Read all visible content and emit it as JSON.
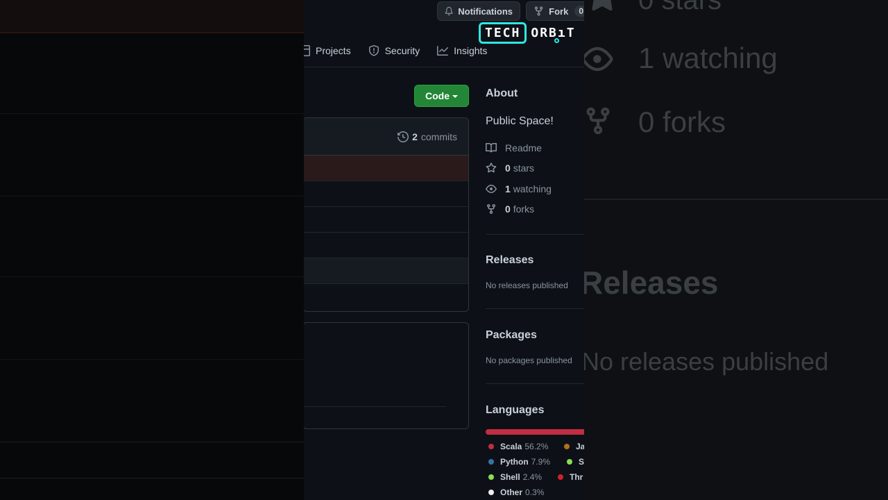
{
  "header": {
    "notifications_label": "Notifications",
    "fork_label": "Fork",
    "fork_count": "0"
  },
  "logo": {
    "part1": "TECH",
    "part2": "ORB",
    "part3": "T"
  },
  "tabs": [
    {
      "label": "Projects",
      "icon": "table-icon"
    },
    {
      "label": "Security",
      "icon": "shield-icon"
    },
    {
      "label": "Insights",
      "icon": "graph-icon"
    }
  ],
  "code_button": "Code",
  "commits": {
    "count": "2",
    "label": "commits"
  },
  "about": {
    "title": "About",
    "description": "Public Space!",
    "readme": "Readme",
    "stars": {
      "count": "0",
      "label": "stars"
    },
    "watching": {
      "count": "1",
      "label": "watching"
    },
    "forks": {
      "count": "0",
      "label": "forks"
    }
  },
  "releases": {
    "title": "Releases",
    "text": "No releases published"
  },
  "packages": {
    "title": "Packages",
    "text": "No packages published"
  },
  "languages": {
    "title": "Languages",
    "items": [
      {
        "name": "Scala",
        "percent": "56.2%",
        "color": "#c22d40"
      },
      {
        "name": "Ja",
        "percent": "",
        "color": "#b07219"
      },
      {
        "name": "Python",
        "percent": "7.9%",
        "color": "#3572A5"
      },
      {
        "name": "S",
        "percent": "",
        "color": "#89e051"
      },
      {
        "name": "Shell",
        "percent": "2.4%",
        "color": "#89e051"
      },
      {
        "name": "Thr",
        "percent": "",
        "color": "#d12127"
      },
      {
        "name": "Other",
        "percent": "0.3%",
        "color": "#ededed"
      }
    ]
  },
  "background_right": {
    "stars_text": "0 stars",
    "watching_text": "1 watching",
    "forks_text": "0 forks",
    "releases_title": "Releases",
    "releases_text": "No releases published"
  }
}
